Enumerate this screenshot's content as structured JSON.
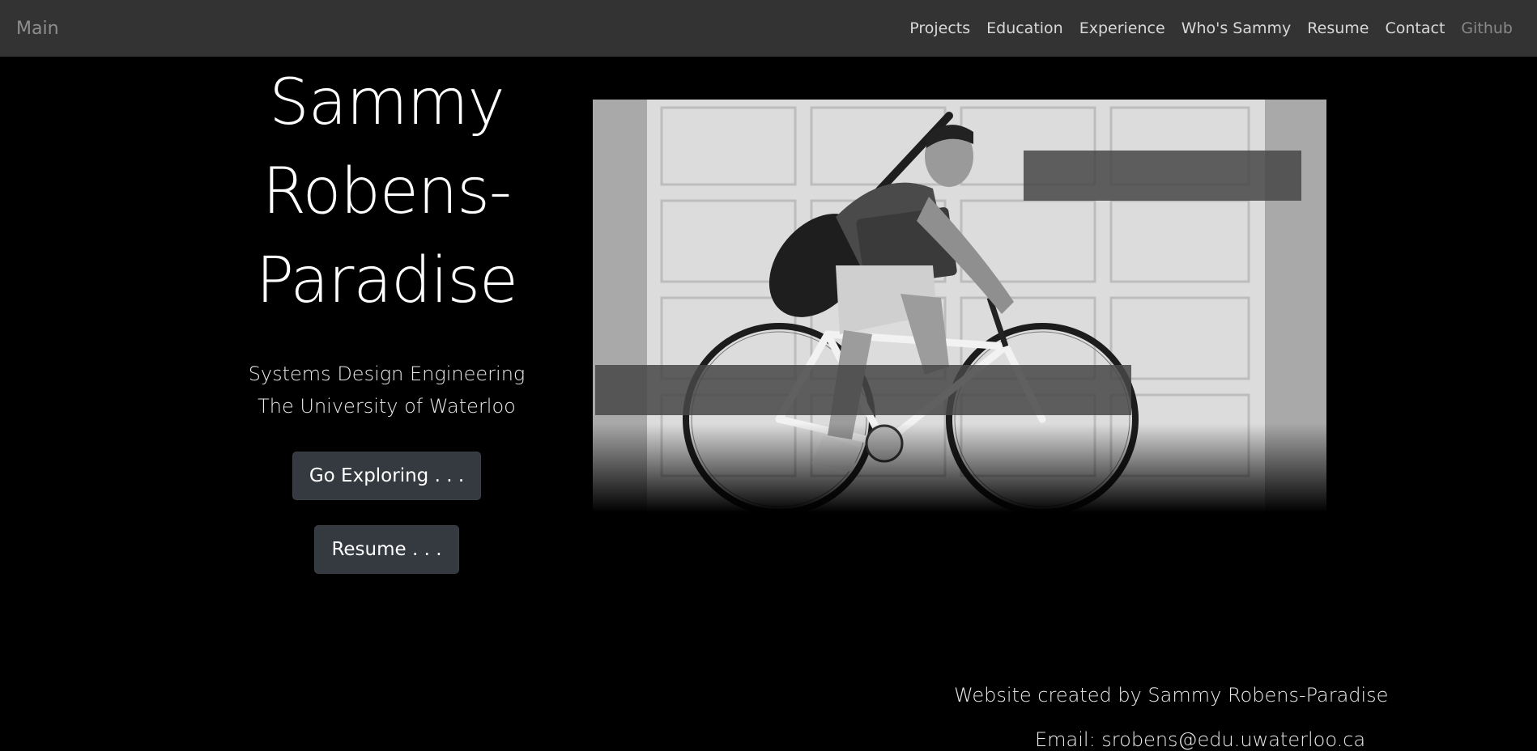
{
  "navbar": {
    "brand": "Main",
    "links": [
      "Projects",
      "Education",
      "Experience",
      "Who's Sammy",
      "Resume",
      "Contact",
      "Github"
    ]
  },
  "hero": {
    "name_line1": "Sammy",
    "name_line2": "Robens-",
    "name_line3": "Paradise",
    "subtitle_line1": "Systems Design Engineering",
    "subtitle_line2": "The University of Waterloo",
    "explore_button": "Go Exploring . . .",
    "resume_button": "Resume . . ."
  },
  "footer": {
    "credit": "Website created by Sammy Robens-Paradise",
    "email": "Email: srobens@edu.uwaterloo.ca"
  }
}
